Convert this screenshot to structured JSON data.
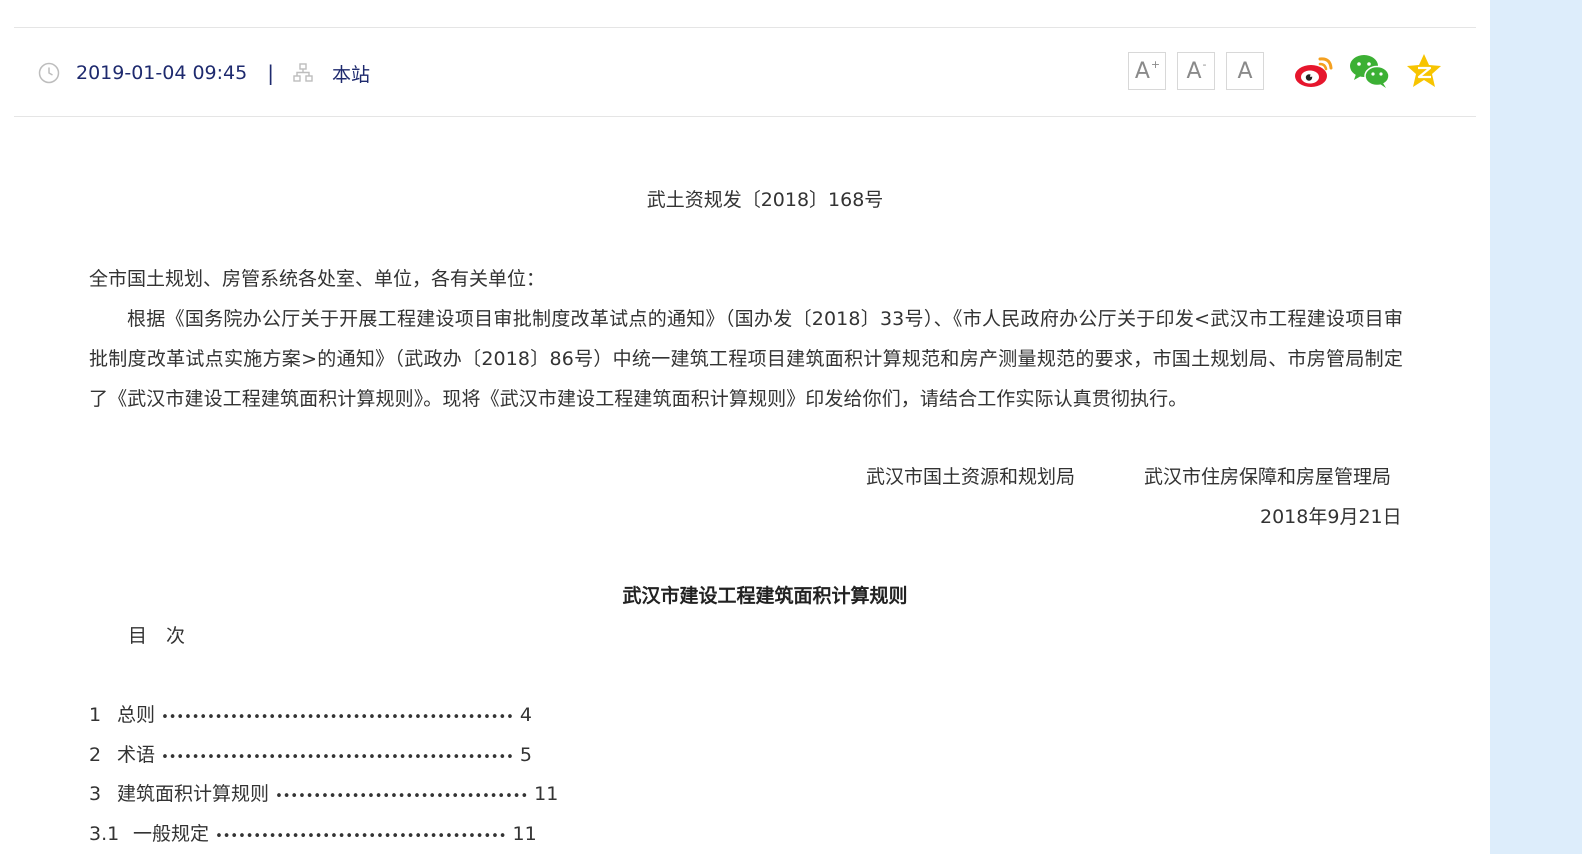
{
  "meta": {
    "date": "2019-01-04 09:45",
    "separator": "|",
    "source": "本站",
    "clock_icon": "clock-icon",
    "site_icon": "sitemap-icon"
  },
  "font_tools": {
    "increase": "A",
    "increase_sup": "+",
    "decrease": "A",
    "decrease_sup": "-",
    "reset": "A"
  },
  "share": {
    "icons": [
      "weibo-icon",
      "wechat-icon",
      "qzone-icon"
    ],
    "colors": {
      "weibo": "#e6162d",
      "weibo_accent": "#f4a020",
      "wechat": "#3cb034",
      "qzone": "#f7c400"
    }
  },
  "article": {
    "doc_number": "武土资规发〔2018〕168号",
    "salutation": "全市国土规划、房管系统各处室、单位，各有关单位：",
    "body": "根据《国务院办公厅关于开展工程建设项目审批制度改革试点的通知》（国办发〔2018〕33号）、《市人民政府办公厅关于印发<武汉市工程建设项目审批制度改革试点实施方案>的通知》（武政办〔2018〕86号）中统一建筑工程项目建筑面积计算规范和房产测量规范的要求，市国土规划局、市房管局制定了《武汉市建设工程建筑面积计算规则》。现将《武汉市建设工程建筑面积计算规则》印发给你们，请结合工作实际认真贯彻执行。",
    "issuer_1": "武汉市国土资源和规划局",
    "issuer_2": "武汉市住房保障和房屋管理局",
    "date": "2018年9月21日",
    "rule_title": "武汉市建设工程建筑面积计算规则",
    "toc_heading": "目　次",
    "toc": [
      {
        "num": "1",
        "title": "总则",
        "dots": "••••••••••••••••••••••••••••••••••••••••••••••",
        "page": "4"
      },
      {
        "num": "2",
        "title": "术语",
        "dots": "••••••••••••••••••••••••••••••••••••••••••••••",
        "page": "5"
      },
      {
        "num": "3",
        "title": "建筑面积计算规则",
        "dots": "•••••••••••••••••••••••••••••••••",
        "page": "11"
      },
      {
        "num": "3.1",
        "title": "一般规定",
        "dots": "••••••••••••••••••••••••••••••••••••••",
        "page": "11"
      }
    ]
  }
}
